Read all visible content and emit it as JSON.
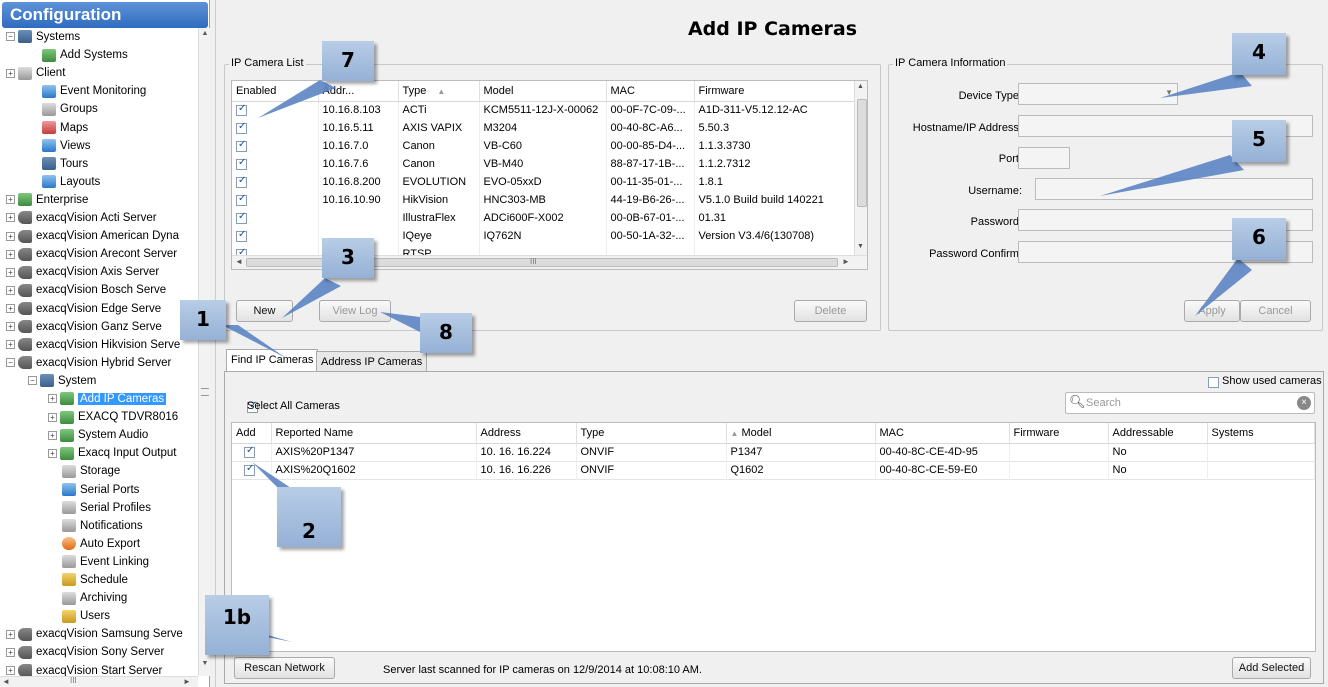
{
  "left": {
    "title": "Configuration",
    "tree": [
      {
        "label": "Systems",
        "icon": "systems-icon"
      },
      {
        "label": "Add Systems",
        "icon": "add-systems-icon"
      },
      {
        "label": "Client",
        "icon": "client-icon"
      },
      {
        "label": "Event Monitoring",
        "icon": "event-monitoring-icon"
      },
      {
        "label": "Groups",
        "icon": "groups-icon"
      },
      {
        "label": "Maps",
        "icon": "maps-icon"
      },
      {
        "label": "Views",
        "icon": "views-icon"
      },
      {
        "label": "Tours",
        "icon": "tours-icon"
      },
      {
        "label": "Layouts",
        "icon": "layouts-icon"
      },
      {
        "label": "Enterprise",
        "icon": "enterprise-icon"
      },
      {
        "label": "exacqVision Acti Server",
        "icon": "server-icon"
      },
      {
        "label": "exacqVision American Dyna",
        "icon": "server-icon"
      },
      {
        "label": "exacqVision Arecont Server",
        "icon": "server-icon"
      },
      {
        "label": "exacqVision Axis Server",
        "icon": "server-icon"
      },
      {
        "label": "exacqVision Bosch Serve",
        "icon": "server-icon"
      },
      {
        "label": "exacqVision Edge Serve",
        "icon": "server-icon"
      },
      {
        "label": "exacqVision Ganz Serve",
        "icon": "server-icon"
      },
      {
        "label": "exacqVision Hikvision Serve",
        "icon": "server-icon"
      },
      {
        "label": "exacqVision Hybrid Server",
        "icon": "server-icon"
      },
      {
        "label": "System",
        "icon": "system-icon"
      },
      {
        "label": "Add IP Cameras",
        "icon": "add-ip-cameras-icon"
      },
      {
        "label": "EXACQ TDVR8016",
        "icon": "dvr-icon"
      },
      {
        "label": "System Audio",
        "icon": "audio-icon"
      },
      {
        "label": "Exacq Input Output",
        "icon": "io-icon"
      },
      {
        "label": "Storage",
        "icon": "storage-icon"
      },
      {
        "label": "Serial Ports",
        "icon": "serial-ports-icon"
      },
      {
        "label": "Serial Profiles",
        "icon": "serial-profiles-icon"
      },
      {
        "label": "Notifications",
        "icon": "notifications-icon"
      },
      {
        "label": "Auto Export",
        "icon": "auto-export-icon"
      },
      {
        "label": "Event Linking",
        "icon": "event-linking-icon"
      },
      {
        "label": "Schedule",
        "icon": "schedule-icon"
      },
      {
        "label": "Archiving",
        "icon": "archiving-icon"
      },
      {
        "label": "Users",
        "icon": "users-icon"
      },
      {
        "label": "exacqVision Samsung Serve",
        "icon": "server-icon"
      },
      {
        "label": "exacqVision Sony Server",
        "icon": "server-icon"
      },
      {
        "label": "exacqVision Start Server",
        "icon": "server-icon"
      }
    ],
    "hscroll_grip": "III"
  },
  "main": {
    "title": "Add IP Cameras",
    "ip_list": {
      "label": "IP Camera List",
      "columns": [
        "Enabled",
        "Addr...",
        "Type",
        "Model",
        "MAC",
        "Firmware"
      ],
      "sort_indicator": "▲",
      "rows": [
        {
          "addr": "10.16.8.103",
          "type": "ACTi",
          "model": "KCM5511-12J-X-00062",
          "mac": "00-0F-7C-09-...",
          "firmware": "A1D-311-V5.12.12-AC"
        },
        {
          "addr": "10.16.5.11",
          "type": "AXIS VAPIX",
          "model": "M3204",
          "mac": "00-40-8C-A6...",
          "firmware": "5.50.3"
        },
        {
          "addr": "10.16.7.0",
          "type": "Canon",
          "model": "VB-C60",
          "mac": "00-00-85-D4-...",
          "firmware": "1.1.3.3730"
        },
        {
          "addr": "10.16.7.6",
          "type": "Canon",
          "model": "VB-M40",
          "mac": "88-87-17-1B-...",
          "firmware": "1.1.2.7312"
        },
        {
          "addr": "10.16.8.200",
          "type": "EVOLUTION",
          "model": "EVO-05xxD",
          "mac": "00-11-35-01-...",
          "firmware": "1.8.1"
        },
        {
          "addr": "10.16.10.90",
          "type": "HikVision",
          "model": "HNC303-MB",
          "mac": "44-19-B6-26-...",
          "firmware": "V5.1.0 Build build 140221"
        },
        {
          "addr": "",
          "type": "IllustraFlex",
          "model": "ADCi600F-X002",
          "mac": "00-0B-67-01-...",
          "firmware": "01.31"
        },
        {
          "addr": "",
          "type": "IQeye",
          "model": "IQ762N",
          "mac": "00-50-1A-32-...",
          "firmware": "Version V3.4/6(130708)"
        },
        {
          "addr": "",
          "type": "RTSP",
          "model": "",
          "mac": "",
          "firmware": ""
        }
      ],
      "hscroll_grip": "III",
      "new_label": "New",
      "view_log_label": "View Log",
      "delete_label": "Delete"
    },
    "ip_info": {
      "label": "IP Camera Information",
      "device_type": "Device Type:",
      "hostname": "Hostname/IP Address:",
      "port": "Port:",
      "username": "Username:",
      "password": "Password:",
      "password_confirm": "Password Confirm:",
      "apply": "Apply",
      "cancel": "Cancel"
    },
    "tabs": [
      "Find IP Cameras",
      "Address IP Cameras"
    ],
    "find": {
      "show_used": "Show used cameras",
      "select_all": "Select All Cameras",
      "search_placeholder": "Search",
      "columns": [
        "Add",
        "Reported Name",
        "Address",
        "Type",
        "Model",
        "MAC",
        "Firmware",
        "Addressable",
        "Systems"
      ],
      "sort_indicator": "▲",
      "rows": [
        {
          "name": "AXIS%20P1347",
          "address": "10. 16. 16.224",
          "type": "ONVIF",
          "model": "P1347",
          "mac": "00-40-8C-CE-4D-95",
          "firmware": "",
          "addressable": "No",
          "systems": ""
        },
        {
          "name": "AXIS%20Q1602",
          "address": "10. 16. 16.226",
          "type": "ONVIF",
          "model": "Q1602",
          "mac": "00-40-8C-CE-59-E0",
          "firmware": "",
          "addressable": "No",
          "systems": ""
        }
      ],
      "rescan_label": "Rescan Network",
      "status": "Server last scanned for IP cameras on 12/9/2014 at 10:08:10 AM.",
      "add_selected_label": "Add Selected"
    }
  },
  "callouts": [
    "7",
    "3",
    "1",
    "8",
    "4",
    "5",
    "6",
    "2",
    "1b"
  ],
  "colors": {
    "selection": "#3399ff",
    "header_blue": "#2f6bbf",
    "callout": "#a9c2e2",
    "arrow": "#5b84c4"
  }
}
